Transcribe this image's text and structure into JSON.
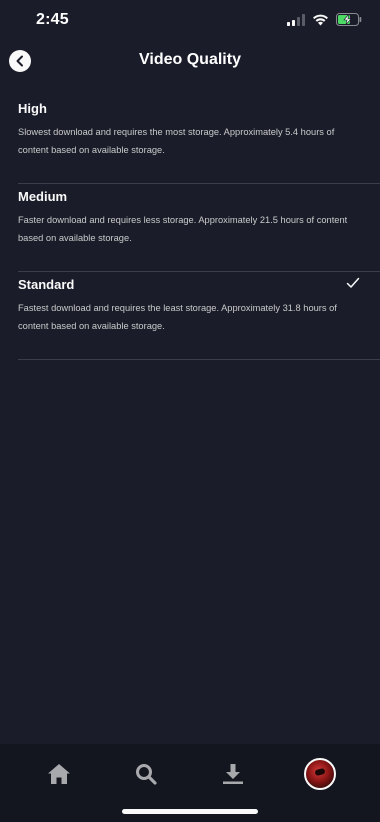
{
  "status_bar": {
    "time": "2:45",
    "icons": [
      "cellular-signal-icon",
      "wifi-icon",
      "battery-charging-icon"
    ]
  },
  "header": {
    "title": "Video Quality",
    "back_icon": "chevron-left-icon"
  },
  "options": [
    {
      "title": "High",
      "description": "Slowest download and requires the most storage. Approximately 5.4 hours of content based on available storage.",
      "selected": false
    },
    {
      "title": "Medium",
      "description": "Faster download and requires less storage. Approximately 21.5 hours of content based on available storage.",
      "selected": false
    },
    {
      "title": "Standard",
      "description": "Fastest download and requires the least storage. Approximately 31.8 hours of content based on available storage.",
      "selected": true
    }
  ],
  "tab_bar": {
    "tabs": [
      "home-icon",
      "search-icon",
      "downloads-icon",
      "profile-avatar"
    ]
  },
  "colors": {
    "background": "#1a1d29",
    "tab_bar": "#14161f",
    "divider": "#3a3d4a",
    "text_primary": "#f9f9f9",
    "text_secondary": "#cacaca",
    "battery_charging": "#4cd964"
  }
}
